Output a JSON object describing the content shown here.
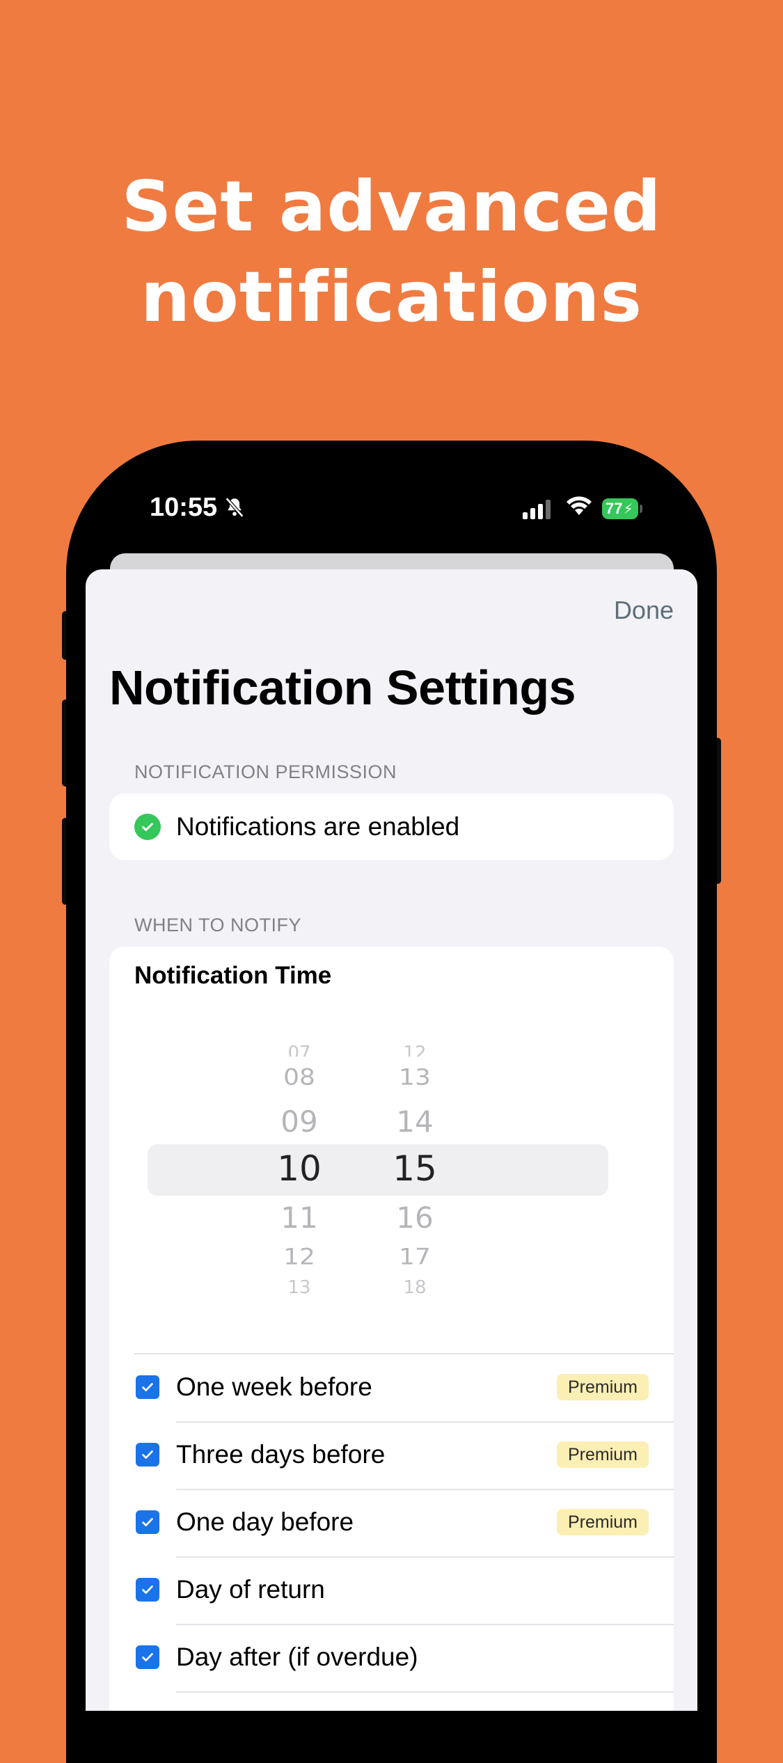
{
  "headline": {
    "line1": "Set advanced",
    "line2": "notifications"
  },
  "status_bar": {
    "time": "10:55",
    "battery": "77"
  },
  "sheet": {
    "done_label": "Done",
    "title": "Notification Settings",
    "permission_section": {
      "header": "NOTIFICATION PERMISSION",
      "status_text": "Notifications are enabled"
    },
    "when_section": {
      "header": "WHEN TO NOTIFY",
      "notification_time_label": "Notification Time",
      "hours": [
        "07",
        "08",
        "09",
        "10",
        "11",
        "12",
        "13"
      ],
      "minutes": [
        "12",
        "13",
        "14",
        "15",
        "16",
        "17",
        "18"
      ],
      "selected_hour": "10",
      "selected_minute": "15",
      "options": [
        {
          "label": "One week before",
          "checked": true,
          "badge": "Premium"
        },
        {
          "label": "Three days before",
          "checked": true,
          "badge": "Premium"
        },
        {
          "label": "One day before",
          "checked": true,
          "badge": "Premium"
        },
        {
          "label": "Day of return",
          "checked": true,
          "badge": ""
        },
        {
          "label": "Day after (if overdue)",
          "checked": true,
          "badge": ""
        }
      ]
    }
  },
  "colors": {
    "background": "#EF7B41",
    "accent": "#1A73E8",
    "success": "#34C759",
    "premium_badge": "#FCEFB4"
  }
}
